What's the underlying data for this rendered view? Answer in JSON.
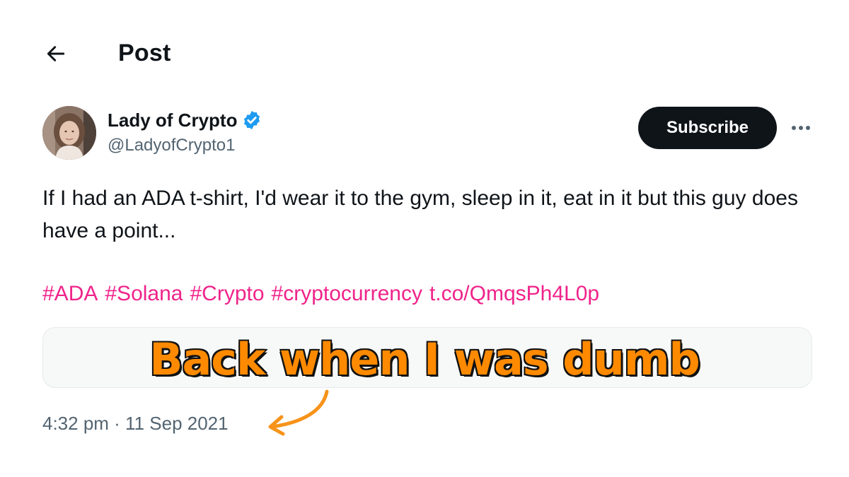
{
  "header": {
    "back_icon": "arrow-left-icon",
    "title": "Post"
  },
  "author": {
    "name": "Lady of Crypto",
    "handle": "@LadyofCrypto1",
    "verified_icon": "verified-badge-icon",
    "verified_color": "#1d9bf0"
  },
  "actions": {
    "subscribe_label": "Subscribe",
    "more_icon": "more-horizontal-icon"
  },
  "tweet": {
    "text": "If I had an ADA t-shirt, I'd wear it to the gym, sleep in it, eat in it but this guy does have a point...",
    "hashtags": [
      "#ADA",
      "#Solana",
      "#Crypto",
      "#cryptocurrency"
    ],
    "link": "t.co/QmqsPh4L0p",
    "link_color": "#f0238a",
    "timestamp": "4:32 pm · 11 Sep 2021"
  },
  "overlay": {
    "caption": "Back when I was dumb",
    "caption_color": "#ff8a00",
    "arrow_icon": "curved-arrow-icon",
    "arrow_color": "#f7931a"
  }
}
